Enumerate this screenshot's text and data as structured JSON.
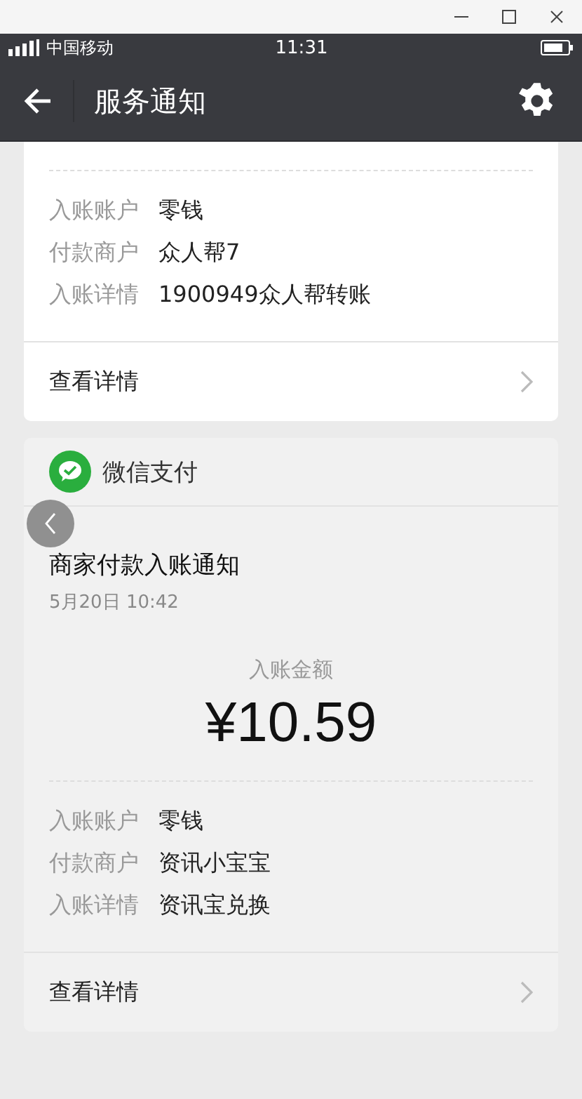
{
  "status_bar": {
    "carrier": "中国移动",
    "time": "11:31"
  },
  "nav": {
    "title": "服务通知"
  },
  "cards": [
    {
      "pressed": false,
      "fields": [
        {
          "label": "入账账户",
          "value": "零钱"
        },
        {
          "label": "付款商户",
          "value": "众人帮7"
        },
        {
          "label": "入账详情",
          "value": "1900949众人帮转账"
        }
      ],
      "footer": "查看详情"
    },
    {
      "pressed": true,
      "header": "微信支付",
      "title": "商家付款入账通知",
      "date": "5月20日  10:42",
      "amount_label": "入账金额",
      "amount": "¥10.59",
      "fields": [
        {
          "label": "入账账户",
          "value": "零钱"
        },
        {
          "label": "付款商户",
          "value": "资讯小宝宝"
        },
        {
          "label": "入账详情",
          "value": "资讯宝兑换"
        }
      ],
      "footer": "查看详情"
    }
  ]
}
